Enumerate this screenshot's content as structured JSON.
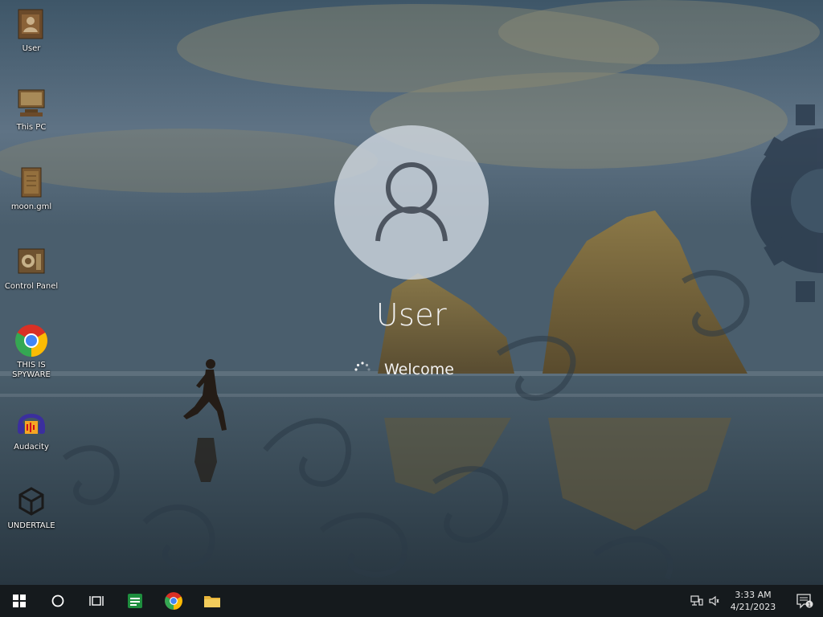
{
  "desktop_icons": [
    {
      "label": "User",
      "icon": "user-folder-icon"
    },
    {
      "label": "This PC",
      "icon": "computer-icon"
    },
    {
      "label": "moon.gml",
      "icon": "file-icon"
    },
    {
      "label": "Control Panel",
      "icon": "control-panel-icon"
    },
    {
      "label": "THIS IS SPYWARE",
      "icon": "chrome-icon"
    },
    {
      "label": "Audacity",
      "icon": "audacity-icon"
    },
    {
      "label": "UNDERTALE",
      "icon": "unity-icon"
    }
  ],
  "login": {
    "username": "User",
    "status": "Welcome",
    "avatar_icon": "user-avatar-icon"
  },
  "taskbar": {
    "pinned": [
      {
        "icon": "windows-start-icon"
      },
      {
        "icon": "cortana-search-icon"
      },
      {
        "icon": "task-view-icon"
      },
      {
        "icon": "sheets-icon"
      },
      {
        "icon": "chrome-icon"
      },
      {
        "icon": "file-explorer-icon"
      }
    ],
    "tray": {
      "time": "3:33 AM",
      "date": "4/21/2023",
      "icons": [
        "network-icon",
        "volume-icon"
      ],
      "notification_badge": "1"
    }
  },
  "colors": {
    "taskbar": "#14181a",
    "avatar_circle": "#cdd6de",
    "text": "#f2f2f2"
  }
}
